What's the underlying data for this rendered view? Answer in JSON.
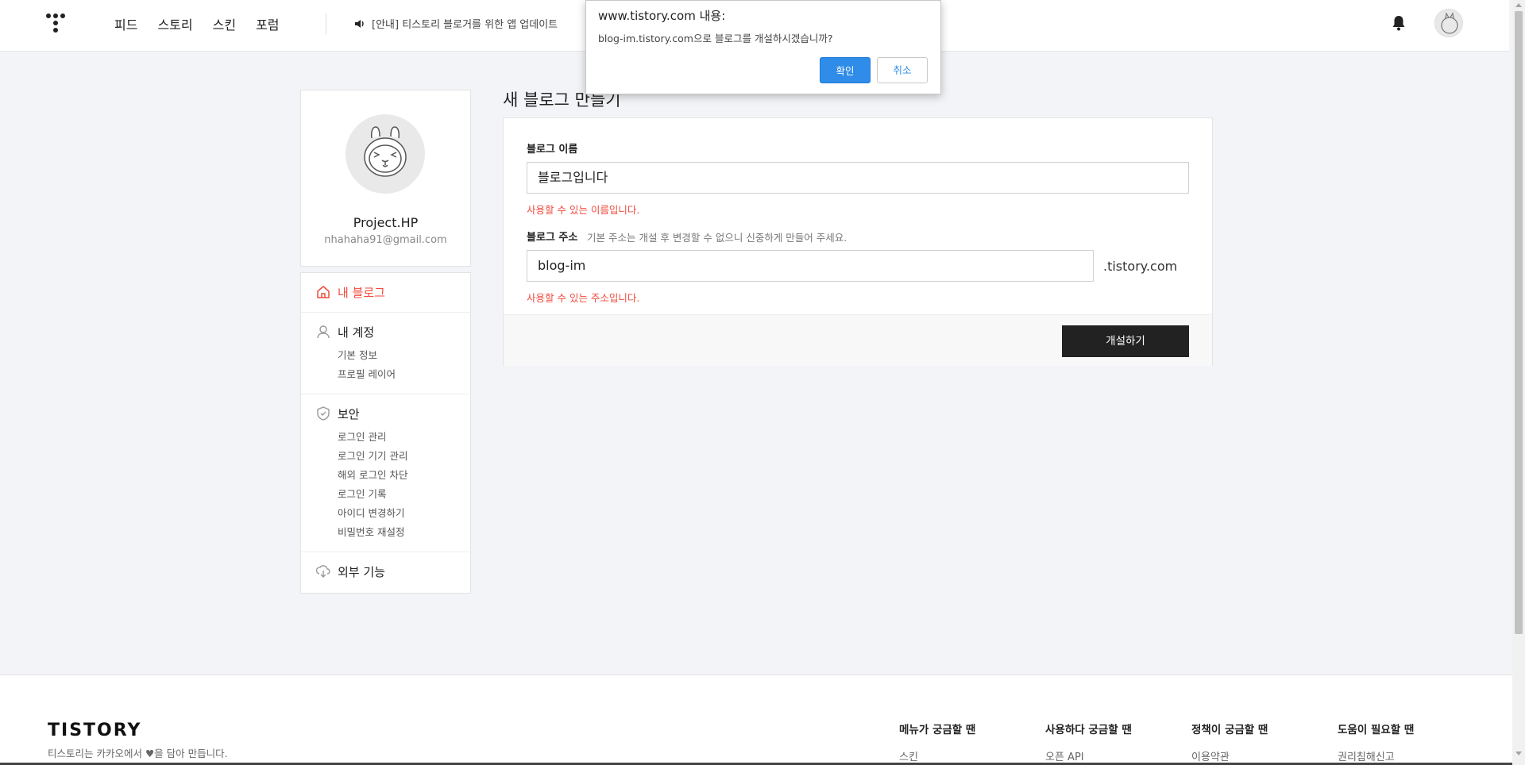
{
  "header": {
    "nav": [
      "피드",
      "스토리",
      "스킨",
      "포럼"
    ],
    "notice": "[안내] 티스토리 블로거를 위한 앱 업데이트"
  },
  "dialog": {
    "title": "www.tistory.com 내용:",
    "message": "blog-im.tistory.com으로 블로그를 개설하시겠습니까?",
    "ok": "확인",
    "cancel": "취소",
    "accent": "#2f8ce8"
  },
  "profile": {
    "name": "Project.HP",
    "email": "nhahaha91@gmail.com"
  },
  "sidebar": {
    "my_blog": "내 블로그",
    "account": {
      "label": "내 계정",
      "items": [
        "기본 정보",
        "프로필 레이어"
      ]
    },
    "security": {
      "label": "보안",
      "items": [
        "로그인 관리",
        "로그인 기기 관리",
        "해외 로그인 차단",
        "로그인 기록",
        "아이디 변경하기",
        "비밀번호 재설정"
      ]
    },
    "external": "외부 기능",
    "active_color": "#f04a3c"
  },
  "main": {
    "title": "새 블로그 만들기",
    "name_label": "블로그 이름",
    "name_value": "블로그입니다",
    "name_valid": "사용할 수 있는 이름입니다.",
    "address_label": "블로그 주소",
    "address_help": "기본 주소는 개설 후 변경할 수 없으니 신중하게 만들어 주세요.",
    "address_value": "blog-im",
    "address_suffix": ".tistory.com",
    "address_valid": "사용할 수 있는 주소입니다.",
    "submit": "개설하기"
  },
  "footer": {
    "logo": "TISTORY",
    "tagline": "티스토리는 카카오에서 ♥을 담아 만듭니다.",
    "columns": [
      {
        "head": "메뉴가 궁금할 땐",
        "link": "스킨"
      },
      {
        "head": "사용하다 궁금할 땐",
        "link": "오픈 API"
      },
      {
        "head": "정책이 궁금할 땐",
        "link": "이용약관"
      },
      {
        "head": "도움이 필요할 땐",
        "link": "권리침해신고"
      }
    ]
  }
}
